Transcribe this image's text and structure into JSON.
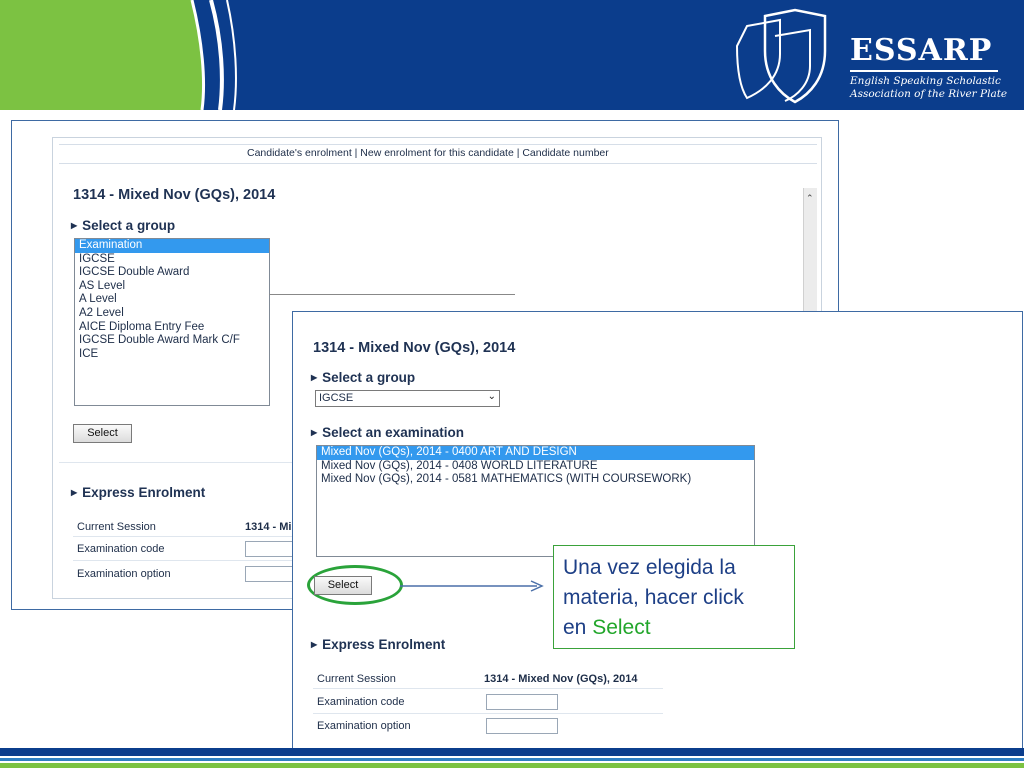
{
  "brand": {
    "name": "ESSARP",
    "subtitle_line1": "English Speaking Scholastic",
    "subtitle_line2": "Association of the River Plate"
  },
  "back_page": {
    "top_links": "Candidate's enrolment | New enrolment for this candidate | Candidate number",
    "exam_title": "1314 - Mixed Nov (GQs), 2014",
    "select_group_heading": "Select a group",
    "group_options": [
      "Examination",
      "IGCSE",
      "IGCSE Double Award",
      "AS Level",
      "A Level",
      "A2 Level",
      "AICE Diploma Entry Fee",
      "IGCSE Double Award Mark C/F",
      "ICE"
    ],
    "select_button": "Select",
    "express_heading": "Express Enrolment",
    "rows": [
      {
        "label": "Current Session",
        "value": "1314 - Mi"
      },
      {
        "label": "Examination code"
      },
      {
        "label": "Examination option"
      }
    ]
  },
  "front_page": {
    "exam_title": "1314 - Mixed Nov (GQs), 2014",
    "select_group_heading": "Select a group",
    "group_selected": "IGCSE",
    "select_exam_heading": "Select an examination",
    "exam_options": [
      "Mixed Nov (GQs), 2014 - 0400 ART AND DESIGN",
      "Mixed Nov (GQs), 2014 - 0408 WORLD LITERATURE",
      "Mixed Nov (GQs), 2014 - 0581 MATHEMATICS (WITH COURSEWORK)"
    ],
    "select_button": "Select",
    "express_heading": "Express Enrolment",
    "rows": [
      {
        "label": "Current Session",
        "value": "1314 - Mixed Nov (GQs), 2014"
      },
      {
        "label": "Examination code"
      },
      {
        "label": "Examination option"
      }
    ]
  },
  "callout": {
    "line1": "Una vez elegida la",
    "line2": "materia, hacer click",
    "line3_prefix": "en ",
    "line3_highlight": "Select"
  },
  "colors": {
    "header_blue": "#0b3d8c",
    "header_green": "#7cc242",
    "selection_blue": "#3399ee",
    "callout_green": "#22a62b",
    "callout_text": "#1d3f86"
  }
}
